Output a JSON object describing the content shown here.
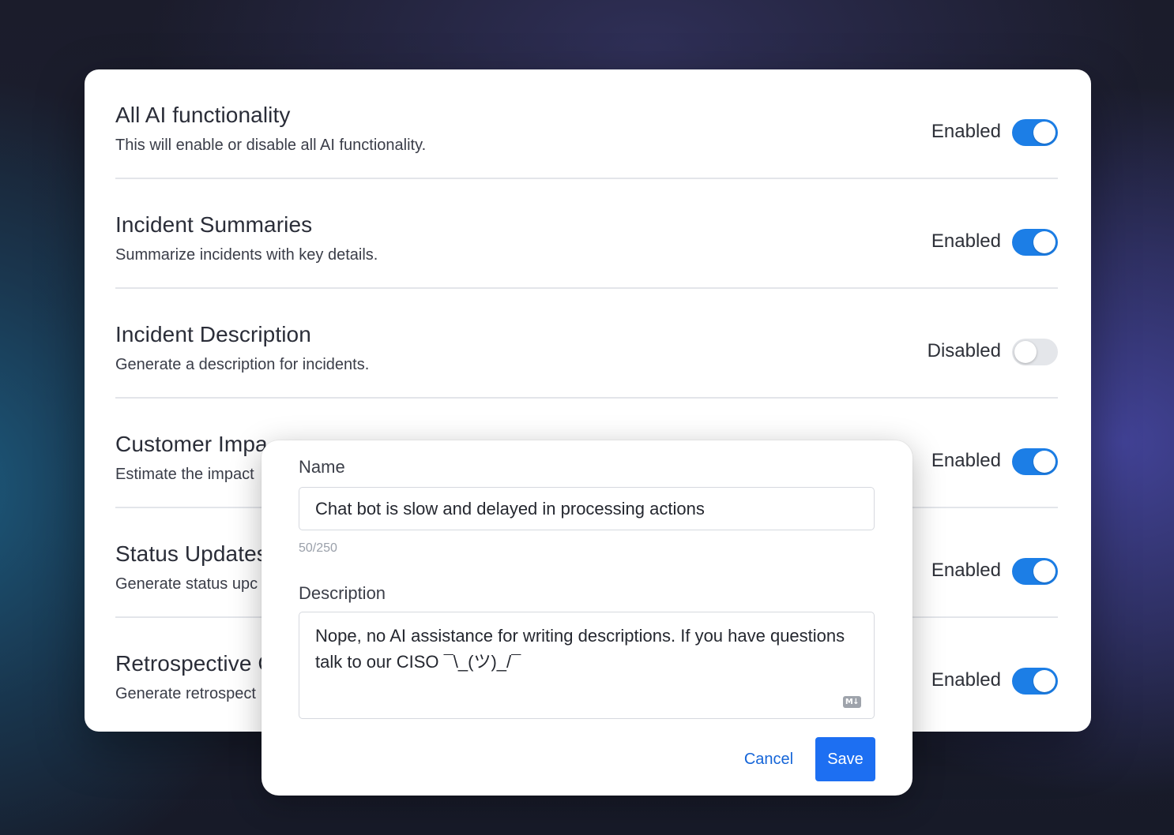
{
  "settings": [
    {
      "title": "All AI functionality",
      "description": "This will enable or disable all AI functionality.",
      "status": "Enabled",
      "enabled": true
    },
    {
      "title": "Incident Summaries",
      "description": "Summarize incidents with key details.",
      "status": "Enabled",
      "enabled": true
    },
    {
      "title": "Incident Description",
      "description": "Generate a description for incidents.",
      "status": "Disabled",
      "enabled": false
    },
    {
      "title": "Customer Impa",
      "description": "Estimate the impact",
      "status": "Enabled",
      "enabled": true
    },
    {
      "title": "Status Updates",
      "description": "Generate status upc",
      "status": "Enabled",
      "enabled": true
    },
    {
      "title": "Retrospective C",
      "description": "Generate retrospect",
      "status": "Enabled",
      "enabled": true
    }
  ],
  "dialog": {
    "name_label": "Name",
    "name_value": "Chat bot is slow and delayed in processing actions",
    "char_count": "50/250",
    "description_label": "Description",
    "description_value": "Nope, no AI assistance for writing descriptions. If you have questions talk to our CISO ¯\\_(ツ)_/¯",
    "markdown_icon_text": "M↓",
    "cancel_label": "Cancel",
    "save_label": "Save"
  },
  "colors": {
    "toggle_on": "#1c7ee6",
    "toggle_off": "#e4e6ea",
    "primary_button": "#1d6ff2",
    "link": "#1565d8"
  },
  "icons": {
    "markdown": "markdown-icon"
  }
}
